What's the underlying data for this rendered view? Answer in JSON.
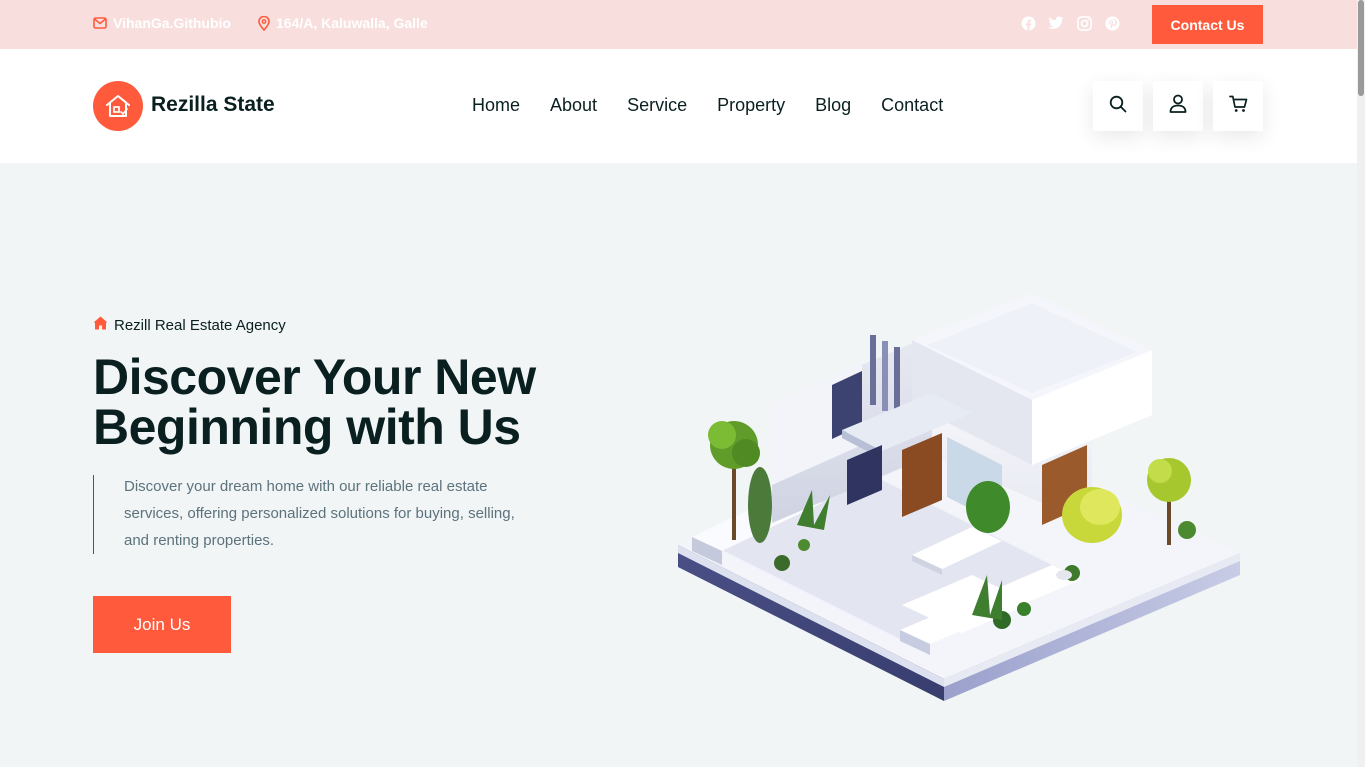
{
  "topbar": {
    "email": "VihanGa.Githubio",
    "address": "164/A, Kaluwalla, Galle",
    "social_icons": [
      "facebook-icon",
      "twitter-icon",
      "instagram-icon",
      "pinterest-icon"
    ],
    "contact_button": "Contact Us"
  },
  "header": {
    "brand": "Rezilla State",
    "nav": [
      "Home",
      "About",
      "Service",
      "Property",
      "Blog",
      "Contact"
    ],
    "actions": [
      "search-icon",
      "user-icon",
      "cart-icon"
    ]
  },
  "hero": {
    "eyebrow": "Rezill Real Estate Agency",
    "headline_line1": "Discover Your New",
    "headline_line2": "Beginning with Us",
    "description": "Discover your dream home with our reliable real estate services, offering personalized solutions for buying, selling, and renting properties.",
    "cta": "Join Us",
    "image": "isometric-house-illustration"
  },
  "colors": {
    "accent": "#ff5a3c",
    "topbar_bg": "#f8dfde",
    "hero_bg": "#f1f5f6",
    "heading": "#0a1f1f",
    "body_text": "#5c727d"
  }
}
